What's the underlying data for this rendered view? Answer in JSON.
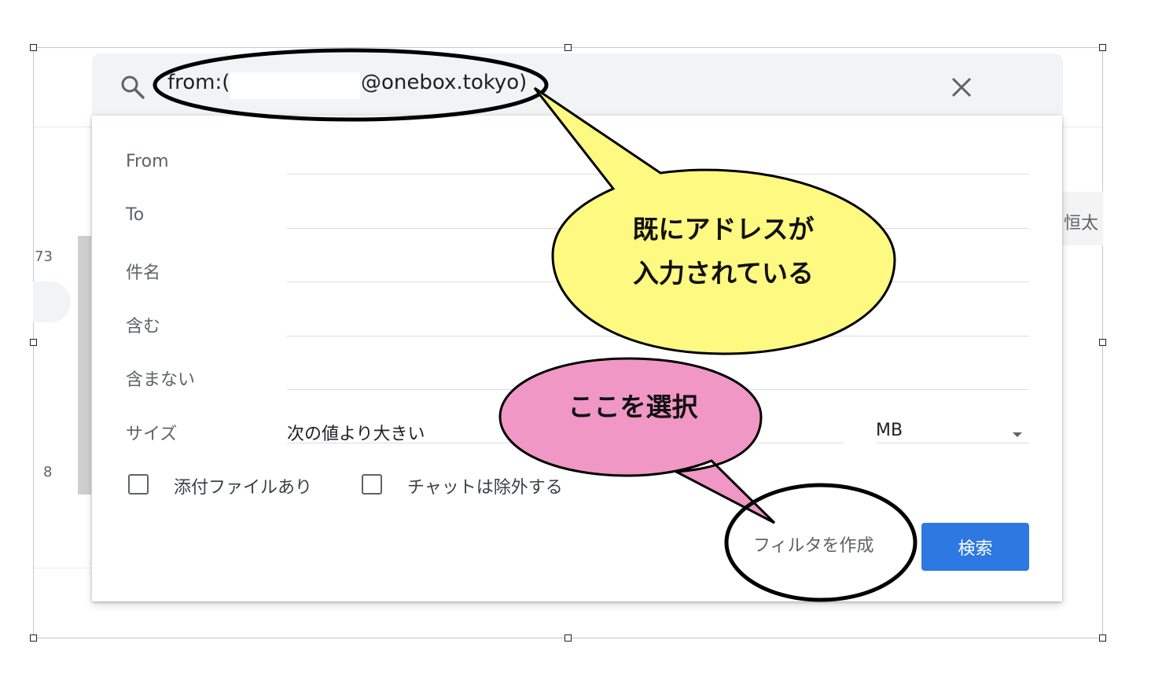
{
  "background": {
    "count_top": "73",
    "count_bottom": "8",
    "sender_name": "恒太"
  },
  "search": {
    "query_prefix": "from:(",
    "query_suffix": "@onebox.tokyo)",
    "search_icon": "search-icon",
    "clear_icon": "close-icon"
  },
  "filter_panel": {
    "fields": [
      {
        "label": "From"
      },
      {
        "label": "To"
      },
      {
        "label": "件名"
      },
      {
        "label": "含む"
      },
      {
        "label": "含まない"
      }
    ],
    "size": {
      "label": "サイズ",
      "comparator": "次の値より大きい",
      "unit": "MB"
    },
    "checkboxes": [
      {
        "label": "添付ファイルあり",
        "checked": false
      },
      {
        "label": "チャットは除外する",
        "checked": false
      }
    ],
    "create_filter_label": "フィルタを作成",
    "search_button_label": "検索"
  },
  "annotations": {
    "yellow_bubble": {
      "line1": "既にアドレスが",
      "line2": "入力されている",
      "color": "#fdf981"
    },
    "pink_bubble": {
      "text": "ここを選択",
      "color": "#f097c5"
    }
  },
  "colors": {
    "primary_button": "#2d78e1",
    "search_bar_bg": "#f1f3f4"
  }
}
